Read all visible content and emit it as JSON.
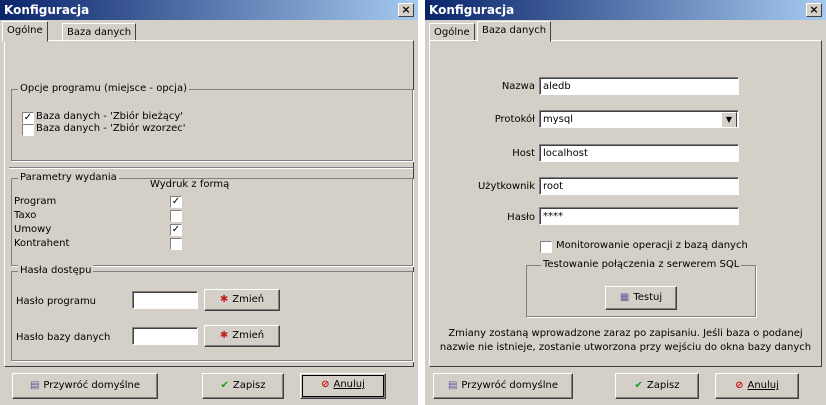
{
  "left_window": {
    "title": "Konfiguracja",
    "close": "×",
    "tabs": [
      "Ogólne",
      "Baza danych"
    ],
    "options_group": {
      "legend": "Opcje programu (miejsce - opcja)",
      "items": [
        {
          "label": "Baza danych - 'Zbiór bieżący'",
          "checked": true
        },
        {
          "label": "Baza danych - 'Zbiór wzorzec'",
          "checked": false
        }
      ]
    },
    "params_group": {
      "legend": "Parametry wydania",
      "column_header": "Wydruk z formą",
      "rows": [
        {
          "label": "Program",
          "checked": true
        },
        {
          "label": "Taxo",
          "checked": false
        },
        {
          "label": "Umowy",
          "checked": true
        },
        {
          "label": "Kontrahent",
          "checked": false
        }
      ]
    },
    "passwords_group": {
      "legend": "Hasła dostępu",
      "program_label": "Hasło programu",
      "program_value": "",
      "db_label": "Hasło bazy danych",
      "db_value": "",
      "change_label": "Zmień"
    },
    "buttons": {
      "restore": "Przywróć domyślne",
      "save": "Zapisz",
      "cancel": "Anuluj"
    }
  },
  "right_window": {
    "title": "Konfiguracja",
    "close": "×",
    "tabs": [
      "Ogólne",
      "Baza danych"
    ],
    "fields": {
      "name_label": "Nazwa",
      "name_value": "aledb",
      "protocol_label": "Protokół",
      "protocol_value": "mysql",
      "host_label": "Host",
      "host_value": "localhost",
      "user_label": "Użytkownik",
      "user_value": "root",
      "password_label": "Hasło",
      "password_value": "****"
    },
    "monitor_label": "Monitorowanie operacji z bazą danych",
    "monitor_checked": false,
    "test_group": {
      "legend": "Testowanie połączenia z serwerem SQL",
      "button": "Testuj"
    },
    "notice": "Zmiany zostaną wprowadzone zaraz po zapisaniu. Jeśli baza o podanej nazwie nie istnieje, zostanie utworzona przy wejściu do okna bazy danych",
    "buttons": {
      "restore": "Przywróć domyślne",
      "save": "Zapisz",
      "cancel": "Anuluj"
    }
  }
}
